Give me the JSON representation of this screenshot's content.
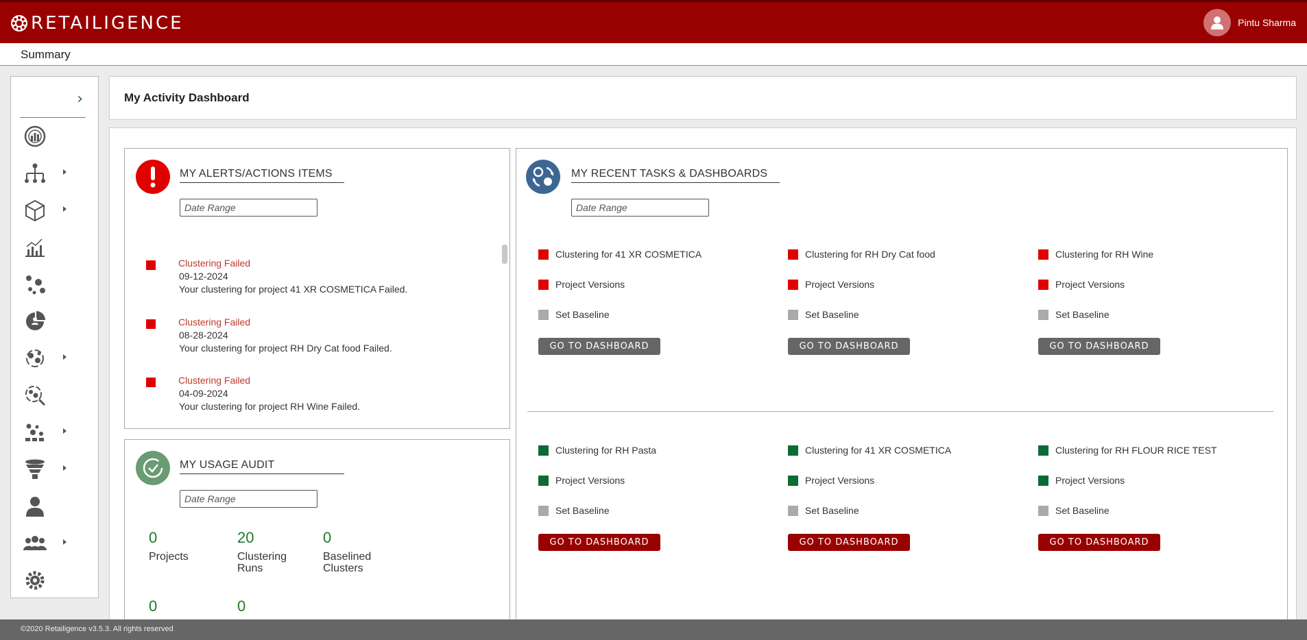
{
  "header": {
    "brand": "RETAILIGENCE",
    "user_name": "Pintu Sharma",
    "brand_color": "#990000"
  },
  "subbar": {
    "title": "Summary"
  },
  "sidebar": {
    "items": [
      {
        "icon": "dashboard-gauge-icon",
        "has_submenu": false
      },
      {
        "icon": "hierarchy-icon",
        "has_submenu": true
      },
      {
        "icon": "cube-icon",
        "has_submenu": true
      },
      {
        "icon": "analytics-chart-icon",
        "has_submenu": false
      },
      {
        "icon": "clustering-icon",
        "has_submenu": false
      },
      {
        "icon": "pie-user-icon",
        "has_submenu": false
      },
      {
        "icon": "cluster-cycle-icon",
        "has_submenu": true
      },
      {
        "icon": "cluster-search-icon",
        "has_submenu": false
      },
      {
        "icon": "cluster-grid-icon",
        "has_submenu": true
      },
      {
        "icon": "funnel-stack-icon",
        "has_submenu": true
      },
      {
        "icon": "user-icon",
        "has_submenu": false
      },
      {
        "icon": "users-group-icon",
        "has_submenu": true
      },
      {
        "icon": "settings-brain-icon",
        "has_submenu": false
      }
    ]
  },
  "page": {
    "title": "My Activity Dashboard"
  },
  "alerts": {
    "heading": "MY ALERTS/ACTIONS ITEMS",
    "date_placeholder": "Date Range",
    "items": [
      {
        "title": "Clustering Failed",
        "date": "09-12-2024",
        "message": "Your clustering for project 41 XR COSMETICA Failed."
      },
      {
        "title": "Clustering Failed",
        "date": "08-28-2024",
        "message": "Your clustering for project RH Dry Cat food Failed."
      },
      {
        "title": "Clustering Failed",
        "date": "04-09-2024",
        "message": "Your clustering for project RH Wine Failed."
      }
    ]
  },
  "usage": {
    "heading": "MY USAGE AUDIT",
    "date_placeholder": "Date Range",
    "stats": [
      {
        "value": "0",
        "label_line1": "Projects",
        "label_line2": ""
      },
      {
        "value": "20",
        "label_line1": "Clustering",
        "label_line2": "Runs"
      },
      {
        "value": "0",
        "label_line1": "Baselined",
        "label_line2": "Clusters"
      },
      {
        "value": "0",
        "label_line1": "",
        "label_line2": ""
      },
      {
        "value": "0",
        "label_line1": "",
        "label_line2": ""
      }
    ]
  },
  "tasks": {
    "heading": "MY RECENT TASKS & DASHBOARDS",
    "date_placeholder": "Date Range",
    "groups": [
      {
        "status_color": "#e00000",
        "button_color": "#666666",
        "cards": [
          {
            "name": "Clustering for 41 XR COSMETICA",
            "versions": "Project Versions",
            "baseline": "Set Baseline",
            "button": "GO TO DASHBOARD"
          },
          {
            "name": "Clustering for RH Dry Cat food",
            "versions": "Project Versions",
            "baseline": "Set Baseline",
            "button": "GO TO DASHBOARD"
          },
          {
            "name": "Clustering for RH Wine",
            "versions": "Project Versions",
            "baseline": "Set Baseline",
            "button": "GO TO DASHBOARD"
          }
        ]
      },
      {
        "status_color": "#0b6b34",
        "button_color": "#990000",
        "cards": [
          {
            "name": "Clustering for RH Pasta",
            "versions": "Project Versions",
            "baseline": "Set Baseline",
            "button": "GO TO DASHBOARD"
          },
          {
            "name": "Clustering for 41 XR COSMETICA",
            "versions": "Project Versions",
            "baseline": "Set Baseline",
            "button": "GO TO DASHBOARD"
          },
          {
            "name": "Clustering for RH FLOUR RICE TEST",
            "versions": "Project Versions",
            "baseline": "Set Baseline",
            "button": "GO TO DASHBOARD"
          }
        ]
      }
    ],
    "baseline_color": "#aaaaaa"
  },
  "footer": {
    "text": "©2020 Retailigence v3.5.3. All rights reserved"
  }
}
